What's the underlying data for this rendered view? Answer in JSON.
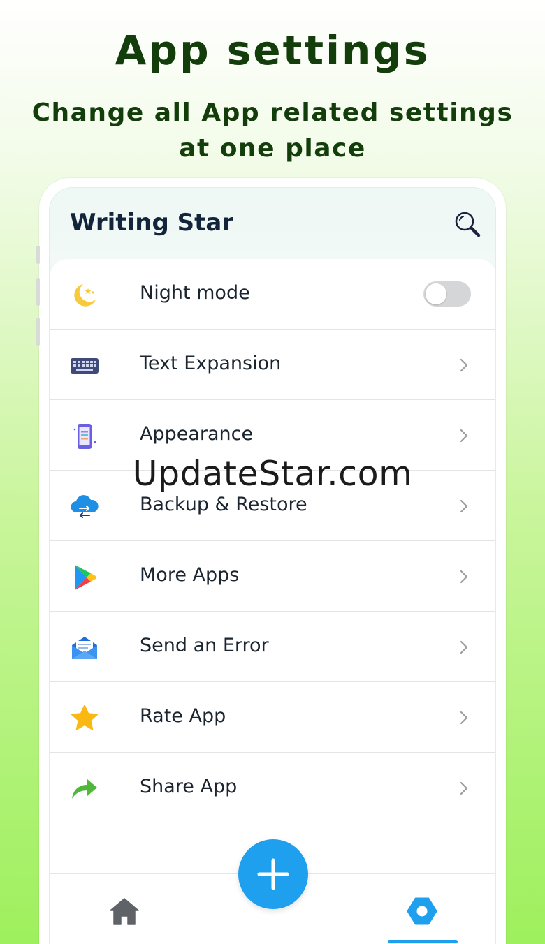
{
  "promo": {
    "title": "App settings",
    "subtitle": "Change all App related settings at one place"
  },
  "app": {
    "title": "Writing Star",
    "search_icon": "search-icon"
  },
  "settings": [
    {
      "label": "Night mode",
      "icon": "moon-icon",
      "control": "toggle",
      "toggle_on": false
    },
    {
      "label": "Text Expansion",
      "icon": "keyboard-icon",
      "control": "chevron"
    },
    {
      "label": "Appearance",
      "icon": "phone-theme-icon",
      "control": "chevron"
    },
    {
      "label": "Backup & Restore",
      "icon": "cloud-sync-icon",
      "control": "chevron"
    },
    {
      "label": "More Apps",
      "icon": "play-store-icon",
      "control": "chevron"
    },
    {
      "label": "Send an Error",
      "icon": "mail-icon",
      "control": "chevron"
    },
    {
      "label": "Rate App",
      "icon": "star-icon",
      "control": "chevron"
    },
    {
      "label": "Share App",
      "icon": "share-arrow-icon",
      "control": "chevron"
    }
  ],
  "watermark": "UpdateStar.com",
  "bottom_nav": {
    "items": [
      {
        "icon": "home-icon",
        "active": false
      },
      {
        "icon": "settings-icon",
        "active": true
      }
    ],
    "fab_icon": "plus-icon"
  },
  "colors": {
    "accent": "#1ea0ef",
    "title_green": "#133d0b",
    "text_dark": "#1b2530",
    "background_green": "#9ef05d"
  }
}
